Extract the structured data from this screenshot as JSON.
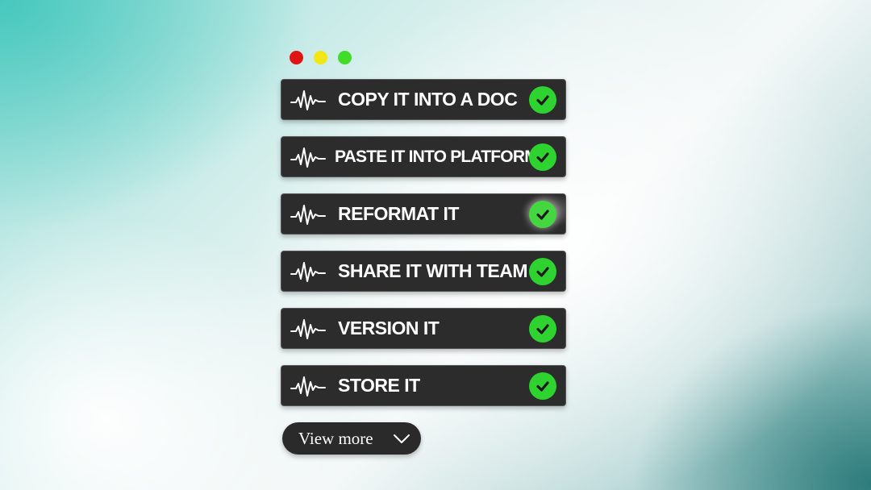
{
  "window_controls": [
    {
      "name": "close",
      "color": "#e01414"
    },
    {
      "name": "minimize",
      "color": "#f2e614"
    },
    {
      "name": "maximize",
      "color": "#3fdc2a"
    }
  ],
  "tasks": [
    {
      "label": "COPY IT INTO A DOC",
      "icon": "waveform-icon",
      "status_icon": "check-icon"
    },
    {
      "label": "PASTE IT INTO PLATFORM",
      "icon": "waveform-icon",
      "status_icon": "check-icon"
    },
    {
      "label": "REFORMAT IT",
      "icon": "waveform-icon",
      "status_icon": "check-icon"
    },
    {
      "label": "SHARE IT WITH TEAM",
      "icon": "waveform-icon",
      "status_icon": "check-icon"
    },
    {
      "label": "VERSION IT",
      "icon": "waveform-icon",
      "status_icon": "check-icon"
    },
    {
      "label": "STORE IT",
      "icon": "waveform-icon",
      "status_icon": "check-icon"
    }
  ],
  "view_more": {
    "label": "View more",
    "icon": "chevron-down-icon"
  },
  "colors": {
    "row_background": "#2c2c2c",
    "check_green": "#2fd330",
    "text": "#ffffff"
  }
}
